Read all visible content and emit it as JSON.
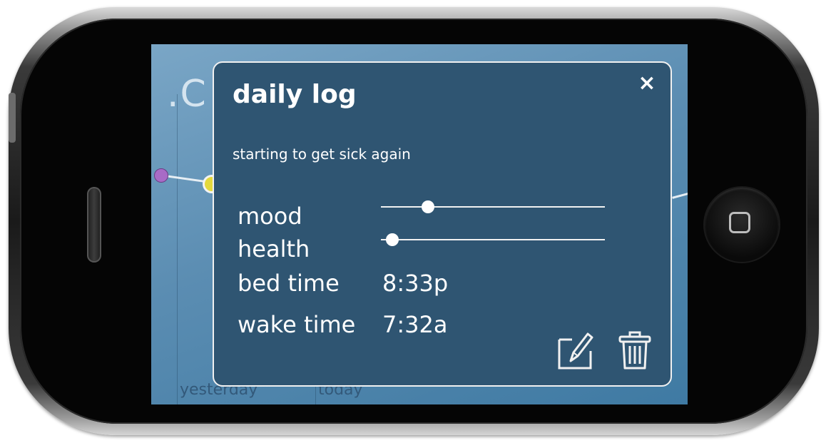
{
  "background": {
    "title_fragment": ".C",
    "axis_labels": [
      "yesterday",
      "today"
    ]
  },
  "popup": {
    "title": "daily log",
    "close_symbol": "×",
    "note": "starting to get sick again",
    "rows": {
      "mood": {
        "label": "mood",
        "level": 0.21
      },
      "health": {
        "label": "health",
        "level": 0.05
      },
      "bed_time": {
        "label": "bed time",
        "value": "8:33p"
      },
      "wake_time": {
        "label": "wake time",
        "value": "7:32a"
      }
    },
    "actions": {
      "edit_icon": "edit-icon",
      "delete_icon": "trash-icon"
    }
  },
  "colors": {
    "popup_bg": "#2f5572",
    "screen_bg": "#5b8db2",
    "dot_purple": "#a86bc6",
    "dot_yellow": "#e4d93d"
  }
}
